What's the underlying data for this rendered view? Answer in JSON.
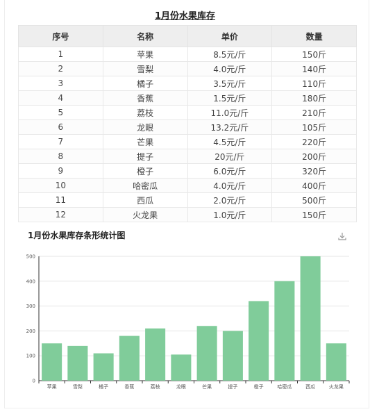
{
  "table": {
    "title": "1月份水果库存",
    "headers": [
      "序号",
      "名称",
      "单价",
      "数量"
    ],
    "rows": [
      [
        "1",
        "苹果",
        "8.5元/斤",
        "150斤"
      ],
      [
        "2",
        "雪梨",
        "4.0元/斤",
        "140斤"
      ],
      [
        "3",
        "橘子",
        "3.5元/斤",
        "110斤"
      ],
      [
        "4",
        "香蕉",
        "1.5元/斤",
        "180斤"
      ],
      [
        "5",
        "荔枝",
        "11.0元/斤",
        "210斤"
      ],
      [
        "6",
        "龙眼",
        "13.2元/斤",
        "105斤"
      ],
      [
        "7",
        "芒果",
        "4.5元/斤",
        "220斤"
      ],
      [
        "8",
        "提子",
        "20元/斤",
        "200斤"
      ],
      [
        "9",
        "橙子",
        "6.0元/斤",
        "320斤"
      ],
      [
        "10",
        "哈密瓜",
        "4.0元/斤",
        "400斤"
      ],
      [
        "11",
        "西瓜",
        "2.0元/斤",
        "500斤"
      ],
      [
        "12",
        "火龙果",
        "1.0元/斤",
        "150斤"
      ]
    ]
  },
  "chart": {
    "title": "1月份水果库存条形统计图",
    "download_icon": "download-icon"
  },
  "colors": {
    "bar": "#80cc9a",
    "grid": "#e6e6e6",
    "header_bg": "#eeeeee"
  },
  "chart_data": {
    "type": "bar",
    "categories": [
      "苹果",
      "雪梨",
      "橘子",
      "香蕉",
      "荔枝",
      "龙眼",
      "芒果",
      "提子",
      "橙子",
      "哈密瓜",
      "西瓜",
      "火龙果"
    ],
    "values": [
      150,
      140,
      110,
      180,
      210,
      105,
      220,
      200,
      320,
      400,
      500,
      150
    ],
    "title": "1月份水果库存条形统计图",
    "xlabel": "",
    "ylabel": "",
    "ylim": [
      0,
      500
    ],
    "yticks": [
      0,
      100,
      200,
      300,
      400,
      500
    ],
    "grid": true
  }
}
